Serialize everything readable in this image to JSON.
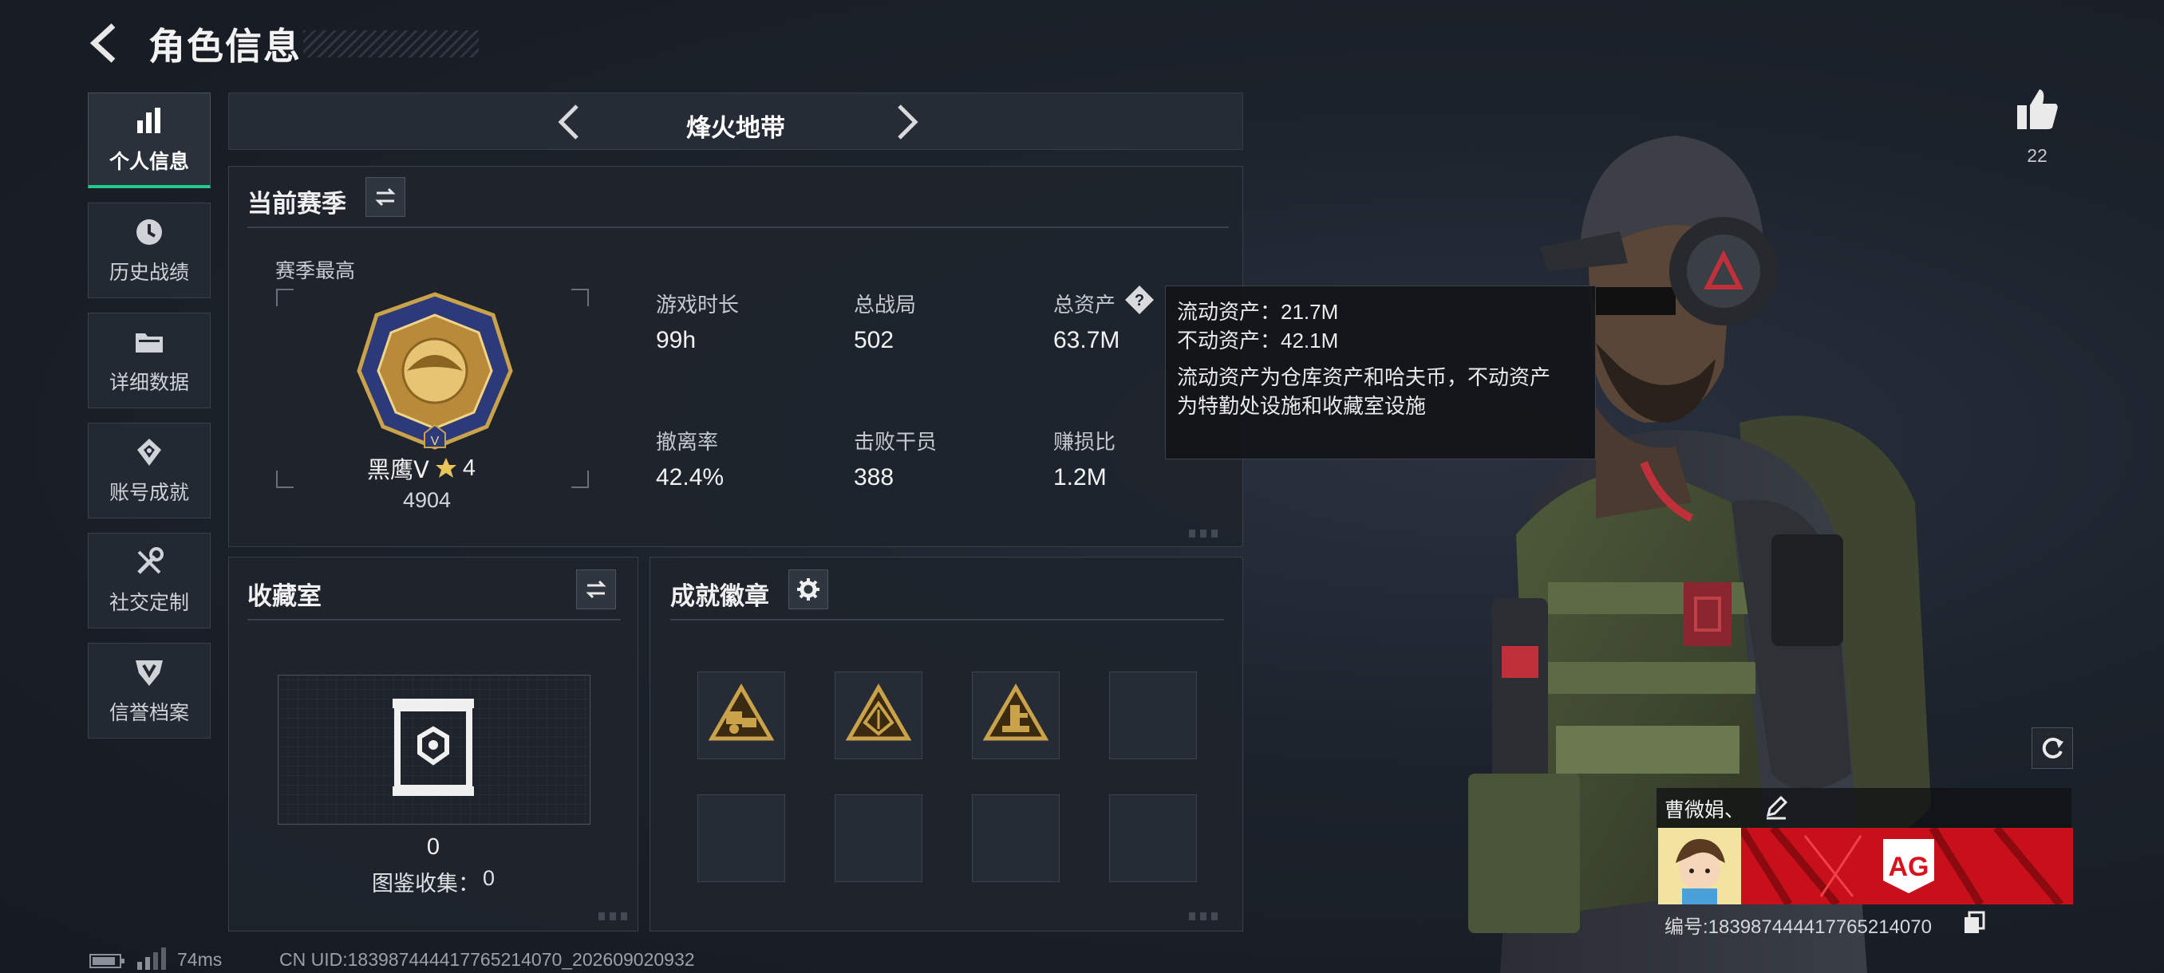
{
  "header": {
    "title": "角色信息"
  },
  "sidebar": {
    "items": [
      {
        "label": "个人信息",
        "icon": "bar-chart-icon",
        "active": true
      },
      {
        "label": "历史战绩",
        "icon": "history-clock-icon"
      },
      {
        "label": "详细数据",
        "icon": "folder-icon"
      },
      {
        "label": "账号成就",
        "icon": "achievement-icon"
      },
      {
        "label": "社交定制",
        "icon": "tools-icon"
      },
      {
        "label": "信誉档案",
        "icon": "credit-shield-icon"
      }
    ]
  },
  "mode_nav": {
    "title": "烽火地带"
  },
  "season": {
    "title": "当前赛季",
    "best_label": "赛季最高",
    "rank_name": "黑鹰Ⅴ",
    "rank_stars": "4",
    "rank_score": "4904",
    "stats": [
      {
        "label": "游戏时长",
        "value": "99h"
      },
      {
        "label": "总战局",
        "value": "502"
      },
      {
        "label": "总资产",
        "value": "63.7M"
      },
      {
        "label": "撤离率",
        "value": "42.4%"
      },
      {
        "label": "击败干员",
        "value": "388"
      },
      {
        "label": "赚损比",
        "value": "1.2M"
      }
    ]
  },
  "tooltip": {
    "liquid": "流动资产：21.7M",
    "fixed": "不动资产：42.1M",
    "desc_line1": "流动资产为仓库资产和哈夫币，不动资产",
    "desc_line2": "为特勤处设施和收藏室设施"
  },
  "collection": {
    "title": "收藏室",
    "count": "0",
    "gallery_label": "图鉴收集：",
    "gallery_value": "0"
  },
  "badges": {
    "title": "成就徽章",
    "slots": [
      {
        "filled": true,
        "icon": "gold-badge-icon"
      },
      {
        "filled": true,
        "icon": "gold-badge-icon"
      },
      {
        "filled": true,
        "icon": "gold-badge-icon"
      },
      {
        "filled": false
      },
      {
        "filled": false
      },
      {
        "filled": false
      },
      {
        "filled": false
      },
      {
        "filled": false
      }
    ]
  },
  "likes": {
    "count": "22"
  },
  "profile": {
    "name": "曹微娟、",
    "id_line": "编号:18398744441776521407​0",
    "card_brand": "AG"
  },
  "status_bar": {
    "ping": "74ms",
    "uid": "CN UID:18398744441776521407​0_202609020932"
  },
  "colors": {
    "accent": "#23c98b",
    "card_red": "#d7141c",
    "gold": "#c9a24a"
  }
}
